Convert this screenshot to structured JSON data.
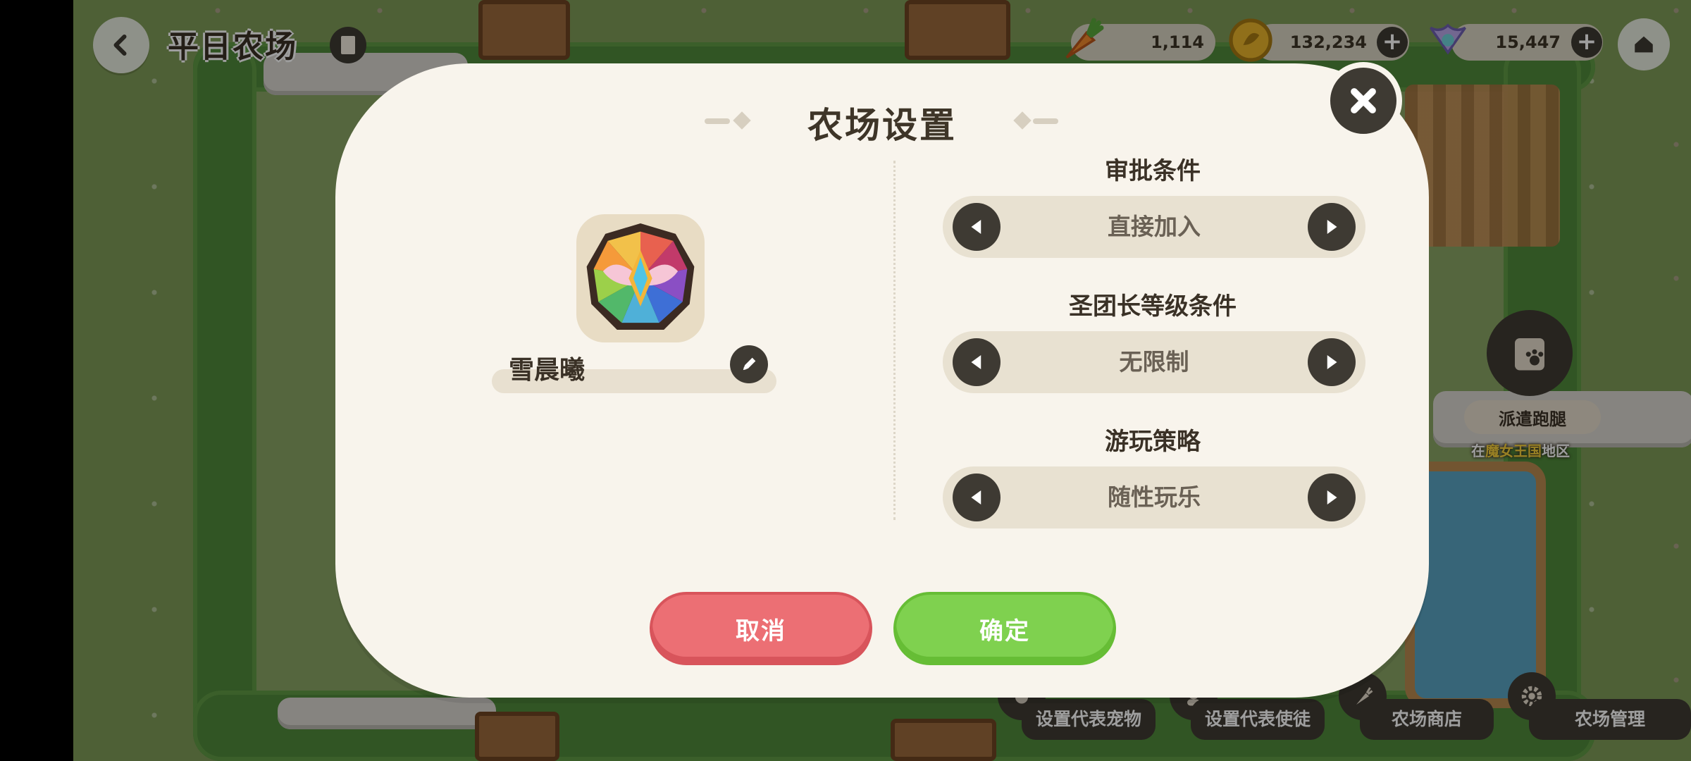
{
  "header": {
    "farm_name": "平日农场",
    "resources": {
      "carrot": "1,114",
      "coin": "132,234",
      "gem": "15,447"
    }
  },
  "dispatch": {
    "label": "派遣跑腿",
    "region_prefix": "在",
    "region_name": "魔女王国",
    "region_suffix": "地区"
  },
  "bottom_actions": {
    "set_pet": "设置代表宠物",
    "set_disciple": "设置代表使徒",
    "farm_shop": "农场商店",
    "farm_manage": "农场管理"
  },
  "modal": {
    "title": "农场设置",
    "player_name": "雪晨曦",
    "settings": [
      {
        "label": "审批条件",
        "value": "直接加入"
      },
      {
        "label": "圣团长等级条件",
        "value": "无限制"
      },
      {
        "label": "游玩策略",
        "value": "随性玩乐"
      }
    ],
    "cancel_label": "取消",
    "confirm_label": "确定"
  },
  "colors": {
    "cancel": "#ec6f74",
    "confirm": "#7fd14f",
    "panel": "#f8f4ec",
    "dark_button": "#3e3a33"
  }
}
